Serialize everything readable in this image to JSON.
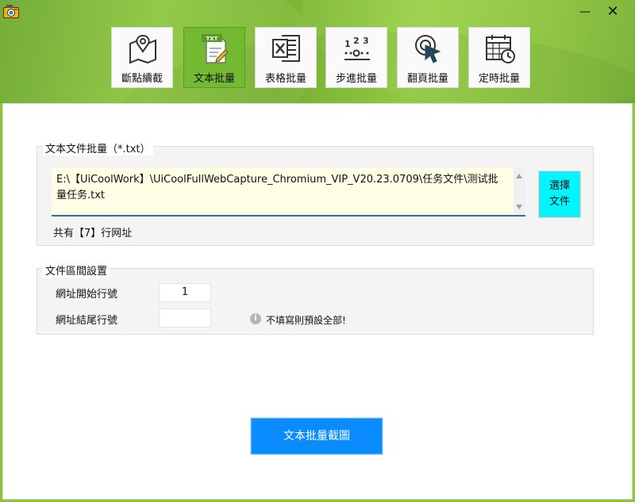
{
  "window": {
    "minimize_glyph": "—",
    "close_glyph": "✕"
  },
  "toolbar": {
    "items": [
      {
        "label": "斷點續截",
        "icon": "map-pin-icon",
        "active": false
      },
      {
        "label": "文本批量",
        "icon": "txt-file-icon",
        "active": true
      },
      {
        "label": "表格批量",
        "icon": "excel-icon",
        "active": false
      },
      {
        "label": "步進批量",
        "icon": "step-numbers-icon",
        "active": false
      },
      {
        "label": "翻頁批量",
        "icon": "cursor-click-icon",
        "active": false
      },
      {
        "label": "定時批量",
        "icon": "calendar-clock-icon",
        "active": false
      }
    ]
  },
  "text_batch": {
    "group_title": "文本文件批量（*.txt）",
    "file_path": "E:\\【UiCoolWork】\\UiCoolFullWebCapture_Chromium_VIP_V20.23.0709\\任务文件\\测试批量任务.txt",
    "select_button_label": "選擇\n文件",
    "count_text": "共有【7】行网址"
  },
  "range_settings": {
    "group_title": "文件區間設置",
    "start_label": "網址開始行號",
    "start_value": "1",
    "end_label": "網址結尾行號",
    "end_value": "",
    "hint_icon": "info-icon",
    "hint_text": "不填寫則預設全部!"
  },
  "actions": {
    "main_button_label": "文本批量截圖"
  },
  "colors": {
    "banner_green": "#8cc63c",
    "active_tab": "#74b932",
    "select_button": "#00f5ff",
    "main_button": "#0a8cff",
    "path_background": "#fffee5"
  }
}
